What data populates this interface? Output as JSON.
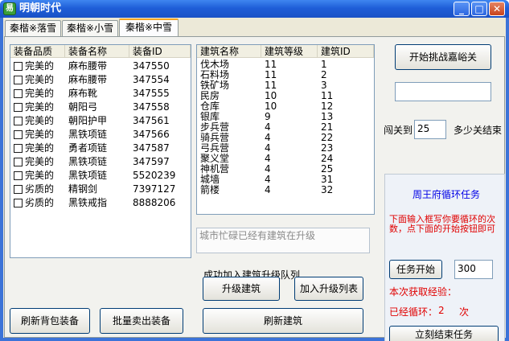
{
  "window": {
    "title": "明朝时代",
    "icon_text": "易"
  },
  "tabs": [
    "秦楷※落雪",
    "秦楷※小雪",
    "秦楷※中雪"
  ],
  "equip": {
    "headers": [
      "装备品质",
      "装备名称",
      "装备ID"
    ],
    "rows": [
      [
        "完美的",
        "麻布腰带",
        "347550"
      ],
      [
        "完美的",
        "麻布腰带",
        "347554"
      ],
      [
        "完美的",
        "麻布靴",
        "347555"
      ],
      [
        "完美的",
        "朝阳弓",
        "347558"
      ],
      [
        "完美的",
        "朝阳护甲",
        "347561"
      ],
      [
        "完美的",
        "黑铁项链",
        "347566"
      ],
      [
        "完美的",
        "勇者项链",
        "347587"
      ],
      [
        "完美的",
        "黑铁项链",
        "347597"
      ],
      [
        "完美的",
        "黑铁项链",
        "5520239"
      ],
      [
        "劣质的",
        "精钢剑",
        "7397127"
      ],
      [
        "劣质的",
        "黑铁戒指",
        "8888206"
      ]
    ]
  },
  "buildings": {
    "headers": [
      "建筑名称",
      "建筑等级",
      "建筑ID"
    ],
    "rows": [
      [
        "伐木场",
        "11",
        "1"
      ],
      [
        "石料场",
        "11",
        "2"
      ],
      [
        "铁矿场",
        "11",
        "3"
      ],
      [
        "民房",
        "10",
        "11"
      ],
      [
        "仓库",
        "10",
        "12"
      ],
      [
        "银库",
        "9",
        "13"
      ],
      [
        "步兵营",
        "4",
        "21"
      ],
      [
        "骑兵营",
        "4",
        "22"
      ],
      [
        "弓兵营",
        "4",
        "23"
      ],
      [
        "聚义堂",
        "4",
        "24"
      ],
      [
        "神机营",
        "4",
        "25"
      ],
      [
        "城墙",
        "4",
        "31"
      ],
      [
        "箭楼",
        "4",
        "32"
      ]
    ]
  },
  "status_box": "城市忙碌已经有建筑在升级",
  "success_msg": "成功加入建筑升级队列",
  "buttons": {
    "challenge": "开始挑战嘉峪关",
    "refresh_bag": "刷新背包装备",
    "sell_bulk": "批量卖出装备",
    "upgrade": "升级建筑",
    "add_queue": "加入升级列表",
    "refresh_build": "刷新建筑",
    "task_start": "任务开始",
    "stop_task": "立刻结束任务"
  },
  "pass": {
    "label_pre": "闯关到",
    "value": "25",
    "label_post": "多少关结束"
  },
  "challenge_input": "",
  "task": {
    "title": "周王府循环任务",
    "desc": "下面输入框写你要循环的次数，点下面的开始按钮即可",
    "count": "300",
    "exp_label": "本次获取经验：",
    "loop_label": "已经循环：",
    "loop_count": "2",
    "loop_unit": "次"
  }
}
